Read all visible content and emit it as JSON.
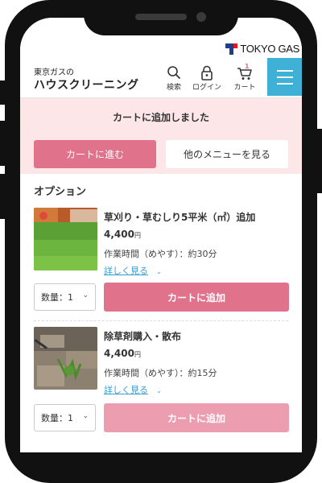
{
  "brand": {
    "name": "TOKYO GAS"
  },
  "header": {
    "logo_line1": "東京ガスの",
    "logo_line2": "ハウスクリーニング",
    "nav": [
      {
        "label": "検索",
        "icon": "search-icon"
      },
      {
        "label": "ログイン",
        "icon": "lock-icon"
      },
      {
        "label": "カート",
        "icon": "cart-icon",
        "badge": "1"
      }
    ],
    "menu_icon": "hamburger-icon"
  },
  "notice": {
    "message": "カートに追加しました",
    "cart_button": "カートに進む",
    "other_button": "他のメニューを見る"
  },
  "options": {
    "title": "オプション",
    "items": [
      {
        "title": "草刈り・草むしり5平米（㎡）追加",
        "price": "4,400",
        "currency": "円",
        "time": "作業時間（めやす）：約30分",
        "more": "詳しく見る",
        "qty": "数量：1",
        "add": "カートに追加"
      },
      {
        "title": "除草剤購入・散布",
        "price": "4,400",
        "currency": "円",
        "time": "作業時間（めやす）：約15分",
        "more": "詳しく見る",
        "qty": "数量：1",
        "add": "カートに追加"
      }
    ]
  },
  "colors": {
    "accent": "#e0728c",
    "notice_bg": "#fde6e8",
    "menu": "#3fb0d6",
    "link": "#3a9fd0"
  }
}
